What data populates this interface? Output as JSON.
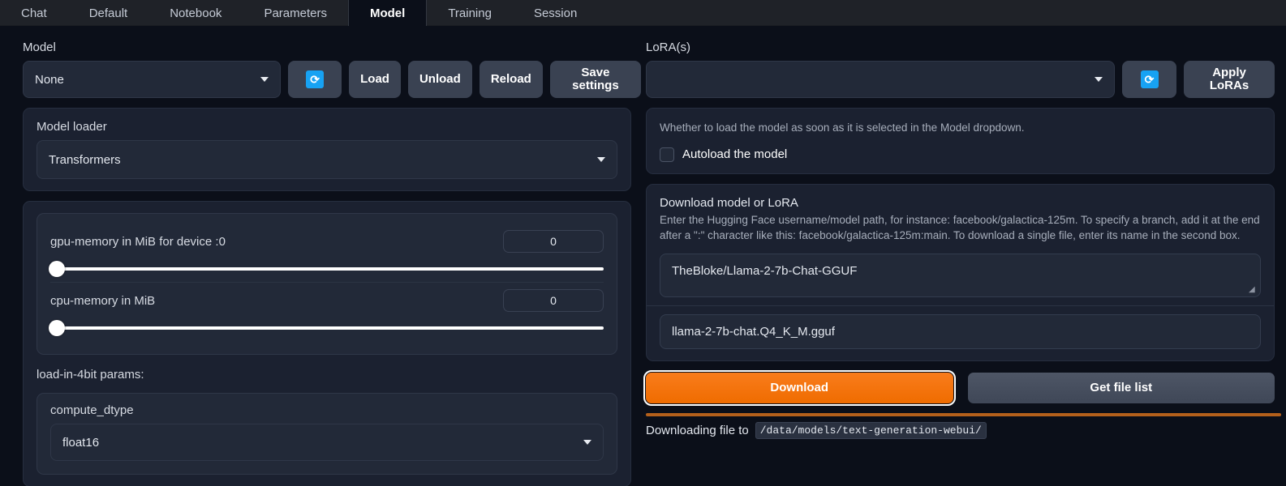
{
  "tabs": [
    {
      "label": "Chat",
      "active": false
    },
    {
      "label": "Default",
      "active": false
    },
    {
      "label": "Notebook",
      "active": false
    },
    {
      "label": "Parameters",
      "active": false
    },
    {
      "label": "Model",
      "active": true
    },
    {
      "label": "Training",
      "active": false
    },
    {
      "label": "Session",
      "active": false
    }
  ],
  "left": {
    "model_label": "Model",
    "model_value": "None",
    "refresh_icon": "refresh-icon",
    "buttons": {
      "load": "Load",
      "unload": "Unload",
      "reload": "Reload",
      "save_settings": "Save settings"
    },
    "model_loader_label": "Model loader",
    "model_loader_value": "Transformers",
    "sliders": [
      {
        "label": "gpu-memory in MiB for device :0",
        "value": "0",
        "percent": 0
      },
      {
        "label": "cpu-memory in MiB",
        "value": "0",
        "percent": 0
      }
    ],
    "params_title": "load-in-4bit params:",
    "compute_dtype_label": "compute_dtype",
    "compute_dtype_value": "float16"
  },
  "right": {
    "lora_label": "LoRA(s)",
    "lora_value": "",
    "refresh_icon": "refresh-icon",
    "apply_loras": "Apply LoRAs",
    "autoload_help": "Whether to load the model as soon as it is selected in the Model dropdown.",
    "autoload_label": "Autoload the model",
    "autoload_checked": false,
    "download_title": "Download model or LoRA",
    "download_help": "Enter the Hugging Face username/model path, for instance: facebook/galactica-125m. To specify a branch, add it at the end after a \":\" character like this: facebook/galactica-125m:main. To download a single file, enter its name in the second box.",
    "repo_value": "TheBloke/Llama-2-7b-Chat-GGUF",
    "file_value": "llama-2-7b-chat.Q4_K_M.gguf",
    "download_button": "Download",
    "getlist_button": "Get file list",
    "status_text": "Downloading file to",
    "status_path": "/data/models/text-generation-webui/",
    "progress_percent": 100
  },
  "colors": {
    "accent_orange": "#ef6c00",
    "progress_orange": "#b4601b",
    "refresh_blue": "#17a2f3",
    "page_bg": "#0b0f19",
    "panel_bg": "#1b2130",
    "control_bg": "#222938"
  }
}
